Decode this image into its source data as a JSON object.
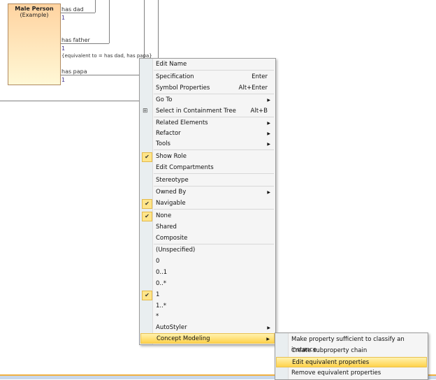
{
  "diagram": {
    "class_name": "Male Person",
    "class_stereotype": "(Example)",
    "roles": [
      {
        "name": "has dad",
        "mult": "1"
      },
      {
        "name": "has father",
        "mult": "1"
      },
      {
        "name": "has papa",
        "mult": "1"
      }
    ],
    "constraint": "{equivalent to = has dad, has papa}"
  },
  "menu": [
    {
      "label": "Edit Name",
      "sep": true
    },
    {
      "label": "Specification",
      "shortcut": "Enter"
    },
    {
      "label": "Symbol Properties",
      "shortcut": "Alt+Enter",
      "sep": true
    },
    {
      "label": "Go To",
      "submenu": true
    },
    {
      "label": "Select in Containment Tree",
      "shortcut": "Alt+B",
      "icon": "containment-tree-icon",
      "sep": true
    },
    {
      "label": "Related Elements",
      "submenu": true
    },
    {
      "label": "Refactor",
      "submenu": true
    },
    {
      "label": "Tools",
      "submenu": true,
      "sep": true
    },
    {
      "label": "Show Role",
      "checked": true
    },
    {
      "label": "Edit Compartments",
      "sep": true
    },
    {
      "label": "Stereotype",
      "sep": true
    },
    {
      "label": "Owned By",
      "submenu": true
    },
    {
      "label": "Navigable",
      "checked": true,
      "sep": true
    },
    {
      "label": "None",
      "checked": true
    },
    {
      "label": "Shared"
    },
    {
      "label": "Composite",
      "sep": true
    },
    {
      "label": "(Unspecified)"
    },
    {
      "label": "0"
    },
    {
      "label": "0..1"
    },
    {
      "label": "0..*"
    },
    {
      "label": "1",
      "checked": true
    },
    {
      "label": "1..*"
    },
    {
      "label": "*"
    },
    {
      "label": "AutoStyler",
      "submenu": true
    },
    {
      "label": "Concept Modeling",
      "submenu": true,
      "highlighted": true
    }
  ],
  "submenu": [
    {
      "label": "Make property sufficient to classify an instance"
    },
    {
      "label": "Create subproperty chain"
    },
    {
      "label": "Edit equivalent properties",
      "highlighted": true
    },
    {
      "label": "Remove equivalent properties"
    }
  ]
}
